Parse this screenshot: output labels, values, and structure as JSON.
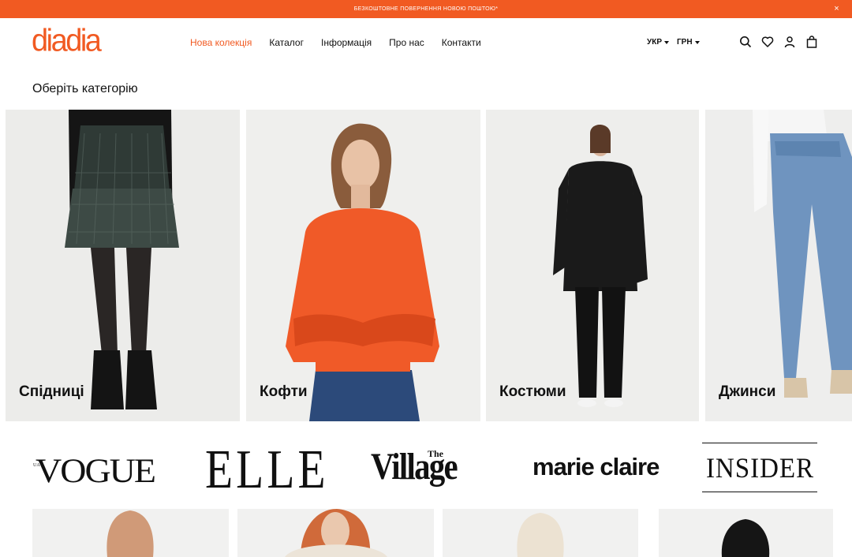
{
  "promo": {
    "text": "БЕЗКОШТОВНЕ ПОВЕРНЕННЯ НОВОЮ ПОШТОЮ*",
    "close": "×"
  },
  "header": {
    "logo": "diadia",
    "nav": [
      "Нова колекція",
      "Каталог",
      "Інформація",
      "Про нас",
      "Контакти"
    ],
    "language": "УКР",
    "currency": "ГРН",
    "icons": [
      "search-icon",
      "heart-icon",
      "user-icon",
      "bag-icon"
    ]
  },
  "categories": {
    "title": "Оберіть категорію",
    "items": [
      "Спідниці",
      "Кофти",
      "Костюми",
      "Джинси"
    ]
  },
  "press": {
    "vogue": "VOGUE",
    "vogue_ua": "UA",
    "elle": "ELLE",
    "village_the": "The",
    "village": "Village",
    "marie_claire": "marie claire",
    "insider": "INSIDER"
  },
  "colors": {
    "accent": "#f15a22",
    "text": "#111111",
    "background": "#ffffff"
  }
}
